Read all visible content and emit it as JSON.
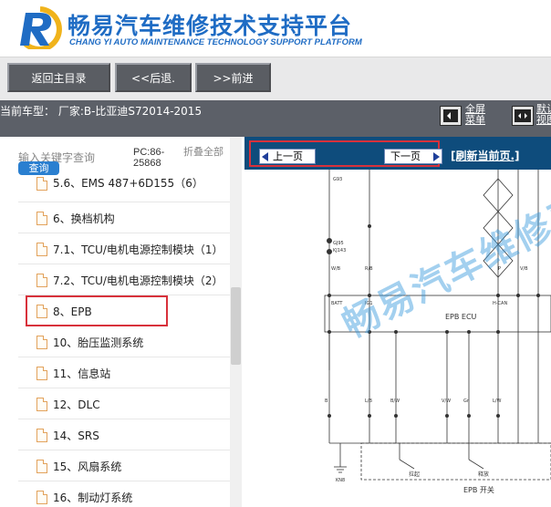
{
  "header": {
    "title": "畅易汽车维修技术支持平台",
    "subtitle": "CHANG YI AUTO MAINTENANCE TECHNOLOGY SUPPORT PLATFORM"
  },
  "toolbar": {
    "home_label": "返回主目录",
    "back_label": "<<后退.",
    "forward_label": ">>前进"
  },
  "infobar": {
    "current_model": "当前车型： 厂家:B-比亚迪S72014-2015",
    "fullscreen_label": "全屏菜单",
    "default_label": "默认视图"
  },
  "sidebar": {
    "search_placeholder": "输入关键字查询",
    "search_button": "查询",
    "pc_code": "PC:86-25868",
    "collapse_all": "折叠全部",
    "items": [
      {
        "label": "5.6、EMS 487+6D155（6）"
      },
      {
        "label": "6、换档机构"
      },
      {
        "label": "7.1、TCU/电机电源控制模块（1）"
      },
      {
        "label": "7.2、TCU/电机电源控制模块（2）"
      },
      {
        "label": "8、EPB"
      },
      {
        "label": "10、胎压监测系统"
      },
      {
        "label": "11、信息站"
      },
      {
        "label": "12、DLC"
      },
      {
        "label": "14、SRS"
      },
      {
        "label": "15、风扇系统"
      },
      {
        "label": "16、制动灯系统"
      }
    ]
  },
  "content": {
    "prev_page": "上一页",
    "next_page": "下一页",
    "refresh": "[刷新当前页.]",
    "watermark": "畅易汽车维修平台",
    "diagram": {
      "ecu_label": "EPB ECU",
      "switch_label": "EPB 开关",
      "ground_label": "KN8",
      "pin_top_left": "BATT",
      "pin_top_ign": "IG1",
      "pin_can": "H-CAN",
      "wire_labels": [
        "W/B",
        "R/B",
        "P",
        "V/B",
        "B",
        "L/B",
        "V/W",
        "Gr",
        "L/W",
        "B/W"
      ],
      "connector_labels": [
        "GJ95",
        "KJ143",
        "G93"
      ],
      "switch_left": "拉起",
      "switch_right": "释放"
    }
  },
  "colors": {
    "brand_blue": "#1f6cc4",
    "highlight_red": "#d8313b",
    "nav_dark": "#0e4c7c",
    "toolbar_button": "#5a5d63"
  }
}
